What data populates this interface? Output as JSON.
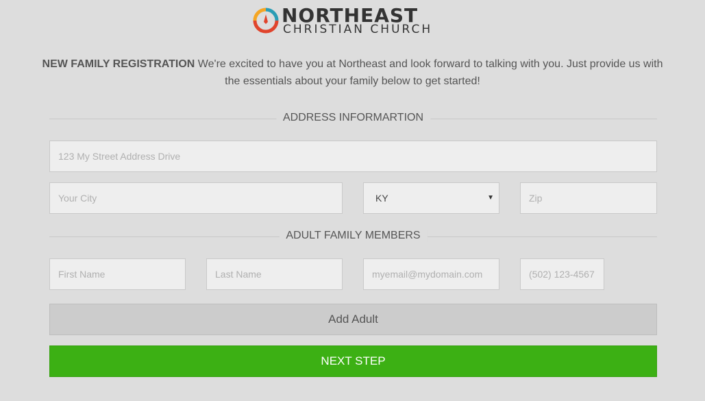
{
  "logo": {
    "line1": "NORTHEAST",
    "line2": "CHRISTIAN CHURCH",
    "colors": [
      "#f5a623",
      "#2a9db5",
      "#e0442c"
    ]
  },
  "intro": {
    "bold": "NEW FAMILY REGISTRATION",
    "text": " We're excited to have you at Northeast and look forward to talking with you. Just provide us with the essentials about your family below to get started!"
  },
  "address_section": {
    "title": "ADDRESS INFORMARTION",
    "street_placeholder": "123 My Street Address Drive",
    "city_placeholder": "Your City",
    "state_value": "KY",
    "zip_placeholder": "Zip"
  },
  "adults_section": {
    "title": "ADULT FAMILY MEMBERS",
    "first_name_placeholder": "First Name",
    "last_name_placeholder": "Last Name",
    "email_placeholder": "myemail@mydomain.com",
    "phone_placeholder": "(502) 123-4567"
  },
  "buttons": {
    "add_adult": "Add Adult",
    "next_step": "NEXT STEP"
  },
  "colors": {
    "background": "#dddddd",
    "primary_green": "#3cb014"
  }
}
